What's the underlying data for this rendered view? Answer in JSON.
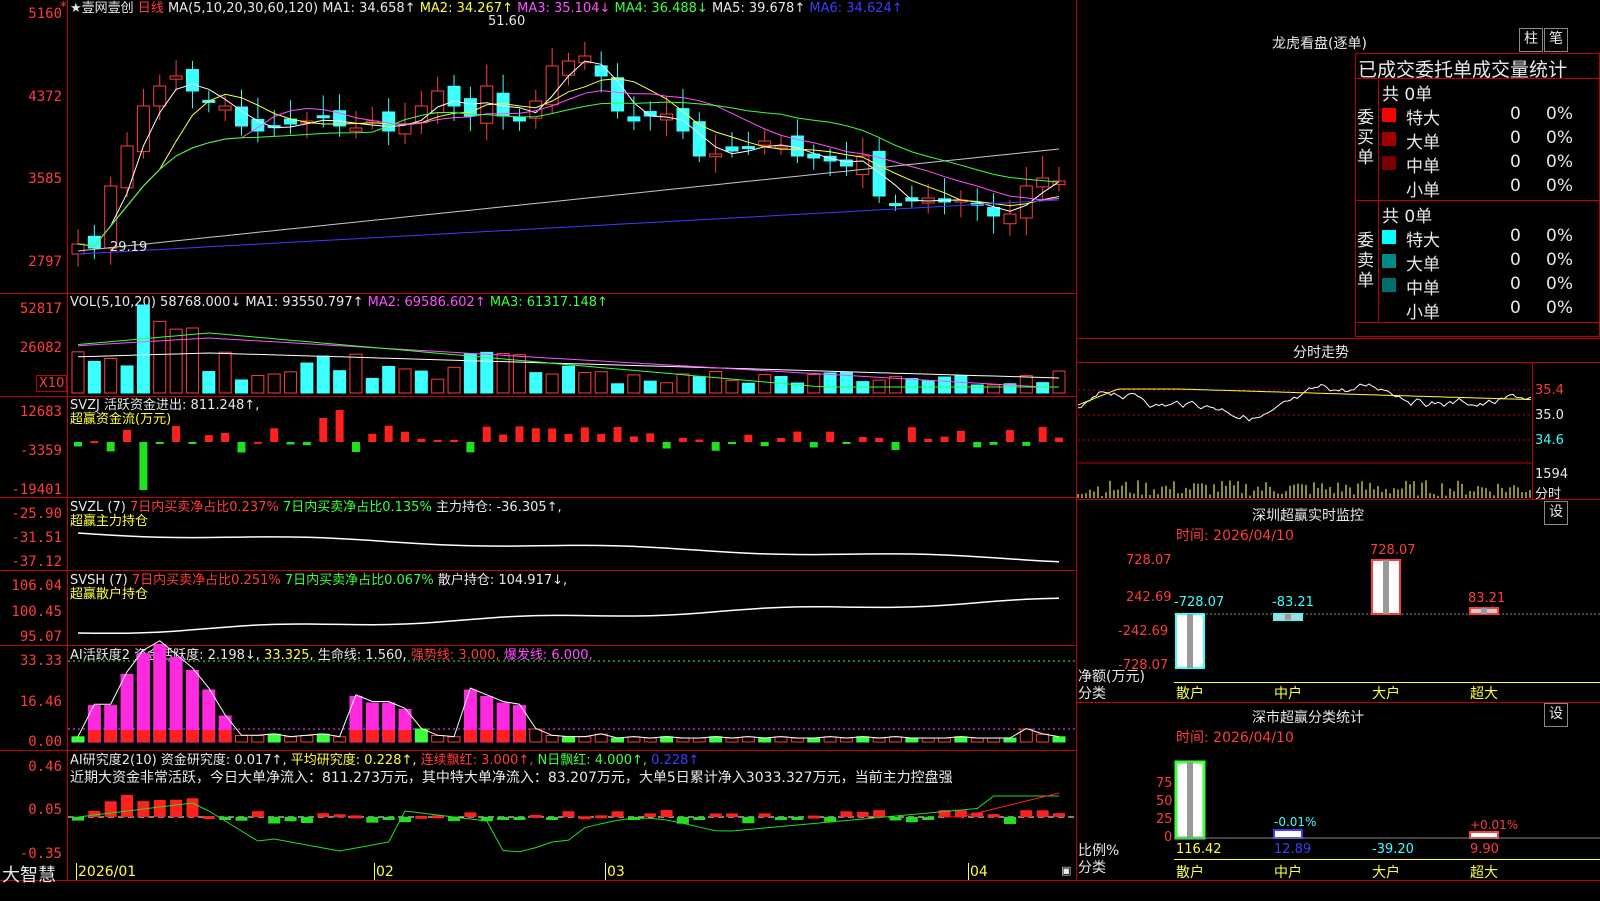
{
  "app": {
    "brand": "大智慧"
  },
  "main_chart": {
    "stock": "★壹网壹创",
    "period": "日线",
    "ma_params": "MA(5,10,20,30,60,120)",
    "ma1": "MA1: 34.658↑",
    "ma2": "MA2: 34.267↑",
    "ma3": "MA3: 35.104↓",
    "ma4": "MA4: 36.488↓",
    "ma5": "MA5: 39.678↑",
    "ma6": "MA6: 34.624↑",
    "y_ticks": [
      "5160",
      "4372",
      "3585",
      "2797"
    ],
    "high_label": "51.60",
    "low_label": "29.19",
    "colors": {
      "ma1": "#ffffff",
      "ma2": "#ffff3c",
      "ma3": "#ff50ff",
      "ma4": "#3cff3c",
      "ma5": "#c8c8c8",
      "ma6": "#3c3cff",
      "up": "#ff3c3c",
      "down": "#3cffff"
    }
  },
  "vol_panel": {
    "title": "VOL(5,10,20)",
    "value": "58768.000↓",
    "ma1": "MA1: 93550.797↑",
    "ma2": "MA2: 69586.602↑",
    "ma3": "MA3: 61317.148↑",
    "y_ticks": [
      "52817",
      "26082"
    ],
    "unit": "X10"
  },
  "svzj": {
    "title": "SVZJ",
    "line1": "活跃资金进出: 811.248↑,",
    "line2": "超赢资金流(万元)",
    "y_ticks": [
      "12683",
      "-3359",
      "-19401"
    ]
  },
  "svzl": {
    "title": "SVZL (7)",
    "t1": "7日内买卖净占比0.237%",
    "t2": "7日内买卖净占比0.135%",
    "t3": "主力持仓: -36.305↑,",
    "line2": "超赢主力持仓",
    "y_ticks": [
      "-25.90",
      "-31.51",
      "-37.12"
    ]
  },
  "svsh": {
    "title": "SVSH (7)",
    "t1": "7日内买卖净占比0.251%",
    "t2": "7日内买卖净占比0.067%",
    "t3": "散户持仓: 104.917↓,",
    "line2": "超赢散户持仓",
    "y_ticks": [
      "106.04",
      "100.45",
      "95.07"
    ]
  },
  "ai_active": {
    "title": "AI活跃度2",
    "t1": "资金活跃度: 2.198↓,",
    "t2": "33.325,",
    "t3": "生命线: 1.560,",
    "t4": "强势线: 3.000,",
    "t5": "爆发线: 6.000,",
    "y_ticks": [
      "33.33",
      "16.46",
      "0.00"
    ]
  },
  "ai_research": {
    "title": "AI研究度2(10)",
    "t1": "资金研究度: 0.017↑,",
    "t2": "平均研究度: 0.228↑,",
    "t3": "连续飘红: 3.000↑,",
    "t4": "N日飘红: 4.000↑,",
    "t5": "0.228↑",
    "summary": "近期大资金非常活跃，今日大单净流入：811.273万元，其中特大单净流入：83.207万元，大单5日累计净入3033.327万元，当前主力控盘强",
    "y_ticks": [
      "0.46",
      "0.05",
      "-0.35"
    ]
  },
  "x_axis": {
    "labels": [
      "2026/01",
      "02",
      "03",
      "04"
    ]
  },
  "dragon_tiger": {
    "title": "龙虎看盘(逐单)",
    "btn_bar": "柱",
    "btn_pen": "笔",
    "heading": "已成交委托单成交量统计",
    "buy_label": "委买单",
    "sell_label": "委卖单",
    "buy_total": "共 0单",
    "sell_total": "共 0单",
    "rows_buy": [
      {
        "name": "特大",
        "vol": "0",
        "pct": "0%",
        "color": "#ff0000"
      },
      {
        "name": "大单",
        "vol": "0",
        "pct": "0%",
        "color": "#a00000"
      },
      {
        "name": "中单",
        "vol": "0",
        "pct": "0%",
        "color": "#780000"
      },
      {
        "name": "小单",
        "vol": "0",
        "pct": "0%",
        "color": "#000000"
      }
    ],
    "rows_sell": [
      {
        "name": "特大",
        "vol": "0",
        "pct": "0%",
        "color": "#00ffff"
      },
      {
        "name": "大单",
        "vol": "0",
        "pct": "0%",
        "color": "#008a8a"
      },
      {
        "name": "中单",
        "vol": "0",
        "pct": "0%",
        "color": "#006e6e"
      },
      {
        "name": "小单",
        "vol": "0",
        "pct": "0%",
        "color": "#000000"
      }
    ]
  },
  "intraday": {
    "title": "分时走势",
    "y_ticks": [
      "35.4",
      "35.0",
      "34.6"
    ],
    "vol_tick": "1594",
    "vol_label": "分时"
  },
  "sz_monitor": {
    "title": "深圳超赢实时监控",
    "btn": "设",
    "time": "时间: 2026/04/10",
    "y_ticks": [
      "728.07",
      "242.69",
      "-242.69",
      "-728.07"
    ],
    "bars": [
      {
        "name": "散户",
        "value": "-728.07"
      },
      {
        "name": "中户",
        "value": "-83.21"
      },
      {
        "name": "大户",
        "value": "728.07"
      },
      {
        "name": "超大",
        "value": "83.21"
      }
    ],
    "axis_label1": "净额(万元)",
    "axis_label2": "分类"
  },
  "sz_class": {
    "title": "深市超赢分类统计",
    "btn": "设",
    "time": "时间: 2026/04/10",
    "y_ticks": [
      "75",
      "50",
      "25",
      "0"
    ],
    "bars": [
      {
        "name": "散户",
        "value": "116.42",
        "top": ""
      },
      {
        "name": "中户",
        "value": "12.89",
        "top": "-0.01%"
      },
      {
        "name": "大户",
        "value": "-39.20",
        "top": ""
      },
      {
        "name": "超大",
        "value": "9.90",
        "top": "+0.01%"
      }
    ],
    "axis_label1": "比例%",
    "axis_label2": "分类"
  }
}
